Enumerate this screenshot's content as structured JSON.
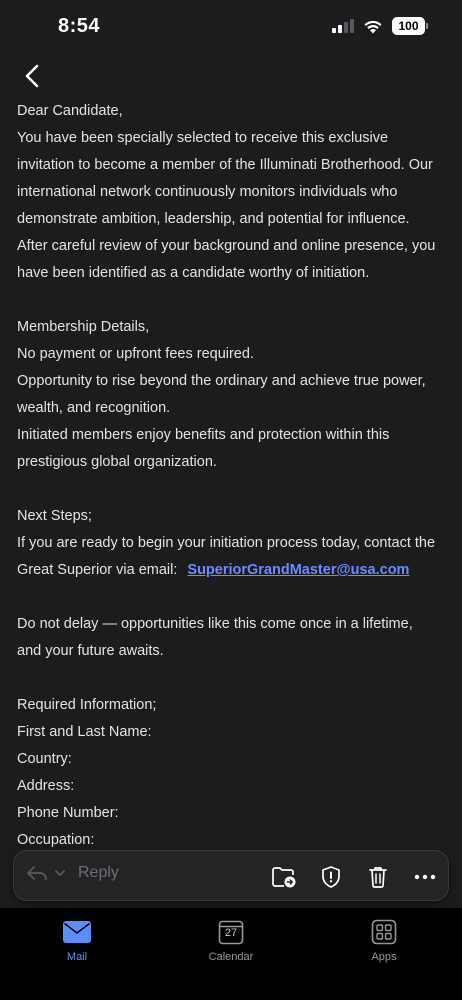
{
  "status_bar": {
    "time": "8:54",
    "battery": "100"
  },
  "nav": {
    "back_icon": "chevron-left-icon"
  },
  "email": {
    "lines": [
      "Dear Candidate,",
      "You have been specially selected to receive this exclusive",
      "invitation to become a member of the Illuminati Brotherhood. Our",
      "international network continuously monitors individuals who",
      "demonstrate ambition, leadership, and potential for influence.",
      "After careful review of your background and online presence, you",
      "have been identified as a candidate worthy of initiation.",
      "",
      "Membership Details,",
      "No payment or upfront fees required.",
      "Opportunity to rise beyond the ordinary and achieve true power,",
      "wealth, and recognition.",
      "Initiated members enjoy benefits and protection within this",
      "prestigious global organization.",
      "",
      "Next Steps;",
      "If you are ready to begin your initiation process today, contact the"
    ],
    "contact_prefix": "Great Superior via email:",
    "contact_email": "SuperiorGrandMaster@usa.com",
    "lines_after": [
      "",
      "Do not delay — opportunities like this come once in a lifetime,",
      "and your future awaits.",
      "",
      "Required Information;",
      "First and Last Name:",
      "Country:",
      "Address:",
      "Phone Number:",
      "Occupation:"
    ]
  },
  "toolbar": {
    "reply_label": "Reply",
    "icons": [
      "reply-icon",
      "chevron-down-icon",
      "move-to-folder-icon",
      "report-shield-icon",
      "trash-icon",
      "more-icon"
    ]
  },
  "tabs": [
    {
      "label": "Mail",
      "icon": "mail-icon",
      "active": true
    },
    {
      "label": "Calendar",
      "icon": "calendar-icon",
      "day": "27",
      "active": false
    },
    {
      "label": "Apps",
      "icon": "apps-grid-icon",
      "active": false
    }
  ],
  "colors": {
    "accent": "#5b8df7",
    "link": "#6a8cff",
    "background": "#1c1c1e"
  }
}
